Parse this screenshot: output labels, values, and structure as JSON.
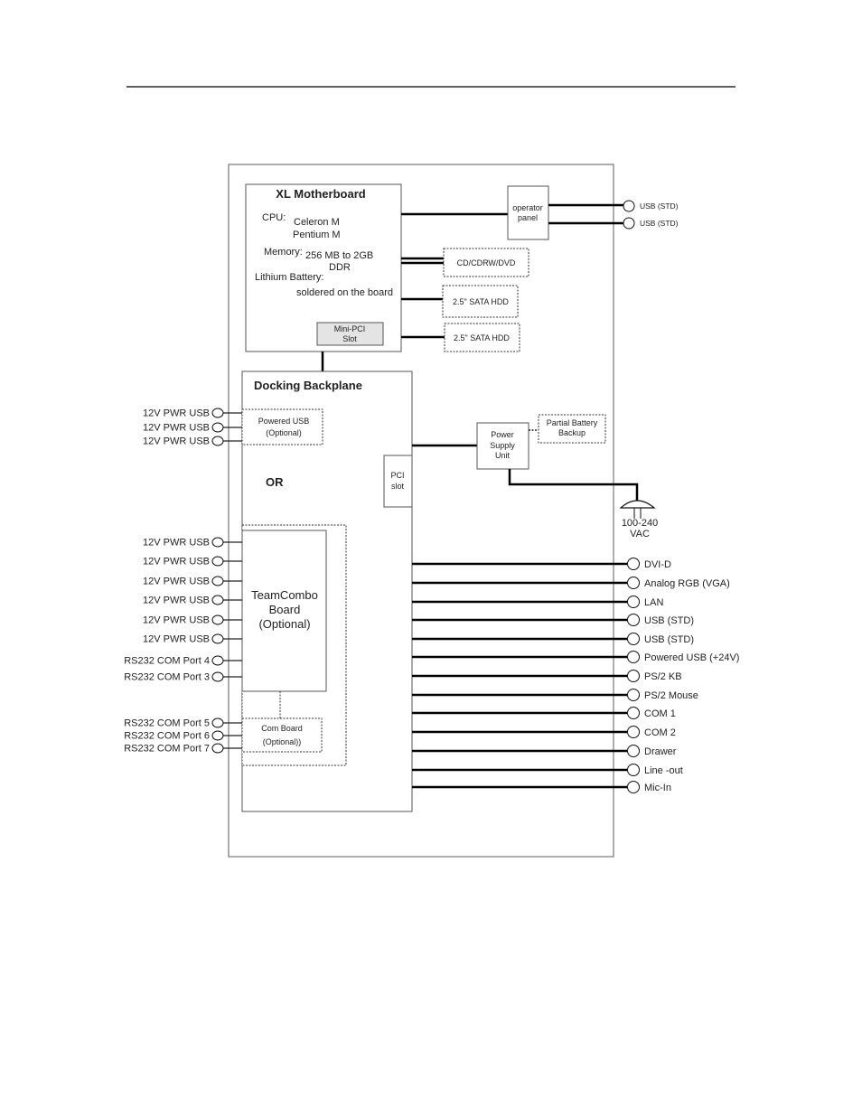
{
  "motherboard": {
    "title": "XL Motherboard",
    "cpu_label": "CPU:",
    "cpu_values": [
      "Celeron M",
      "Pentium M"
    ],
    "memory_label": "Memory:",
    "memory_values": [
      "256 MB to 2GB",
      "DDR"
    ],
    "battery_label": "Lithium Battery:",
    "battery_value": "soldered on the board",
    "minipci": [
      "Mini-PCI",
      "Slot"
    ]
  },
  "operator_panel": {
    "label": [
      "operator",
      "panel"
    ],
    "ports": [
      "USB (STD)",
      "USB (STD)"
    ]
  },
  "drives": [
    "CD/CDRW/DVD",
    "2.5\" SATA HDD",
    "2.5\" SATA HDD"
  ],
  "backplane": {
    "title": "Docking Backplane",
    "or_label": "OR",
    "pci_slot": [
      "PCI",
      "slot"
    ],
    "powered_usb": [
      "Powered USB",
      "(Optional)"
    ],
    "powered_usb_ports": [
      "12V PWR USB",
      "12V PWR USB",
      "12V PWR USB"
    ],
    "teamcombo": [
      "TeamCombo",
      "Board",
      "(Optional)"
    ],
    "teamcombo_ports": [
      "12V PWR USB",
      "12V PWR USB",
      "12V PWR USB",
      "12V PWR USB",
      "12V PWR USB",
      "12V PWR USB",
      "RS232 COM Port  4",
      "RS232 COM Port  3"
    ],
    "com_board": [
      "Com Board",
      "(Optional))"
    ],
    "com_board_ports": [
      "RS232 COM Port  5",
      "RS232 COM Port  6",
      "RS232 COM Port  7"
    ]
  },
  "power": {
    "psu": [
      "Power",
      "Supply",
      "Unit"
    ],
    "battery_backup": [
      "Partial Battery",
      "Backup"
    ],
    "ac": [
      "100-240",
      "VAC"
    ]
  },
  "rear_ports": [
    "DVI-D",
    "Analog RGB (VGA)",
    "LAN",
    "USB (STD)",
    "USB (STD)",
    "Powered USB (+24V)",
    "PS/2 KB",
    "PS/2 Mouse",
    "COM 1",
    "COM 2",
    "Drawer",
    "Line -out",
    "Mic-In"
  ]
}
